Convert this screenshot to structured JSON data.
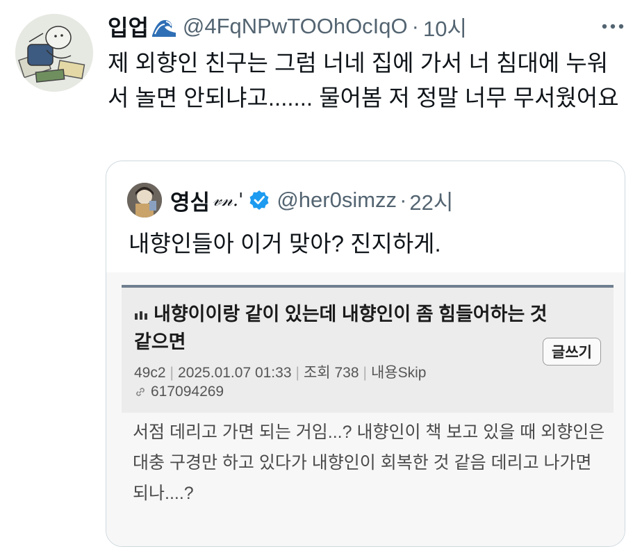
{
  "tweet": {
    "display_name": "입업",
    "name_emoji": "wave-emoji",
    "handle": "@4FqNPwTOOhOcIqO",
    "separator": "·",
    "time": "10시",
    "text": "제 외향인 친구는 그럼 너네 집에 가서 너 침대에 누워서 놀면 안되냐고....... 물어봄 저 정말 너무 무서웠어요",
    "more_icon": "more-horizontal-icon"
  },
  "quote": {
    "display_name": "영심",
    "name_deco": "𝓋𝓃.'",
    "verified_icon": "verified-badge-icon",
    "verified_color": "#1d9bf0",
    "handle": "@her0simzz",
    "separator": "·",
    "time": "22시",
    "text": "내향인들아 이거 맞아? 진지하게.",
    "screenshot": {
      "title": "내향이이랑 같이 있는데 내향인이 좀 힘들어하는 것 같으면",
      "write_button": "글쓰기",
      "meta": {
        "author": "49c2",
        "date": "2025.01.07 01:33",
        "views": "조회 738",
        "skip": "내용Skip"
      },
      "post_id": "617094269",
      "body": "서점 데리고 가면 되는 거임...? 내향인이 책 보고 있을 때 외향인은 대충 구경만 하고 있다가 내향인이 회복한 것 같음 데리고 나가면 되나....?"
    }
  },
  "colors": {
    "text_primary": "#0f1419",
    "text_secondary": "#536471",
    "border": "#cfd9de"
  }
}
